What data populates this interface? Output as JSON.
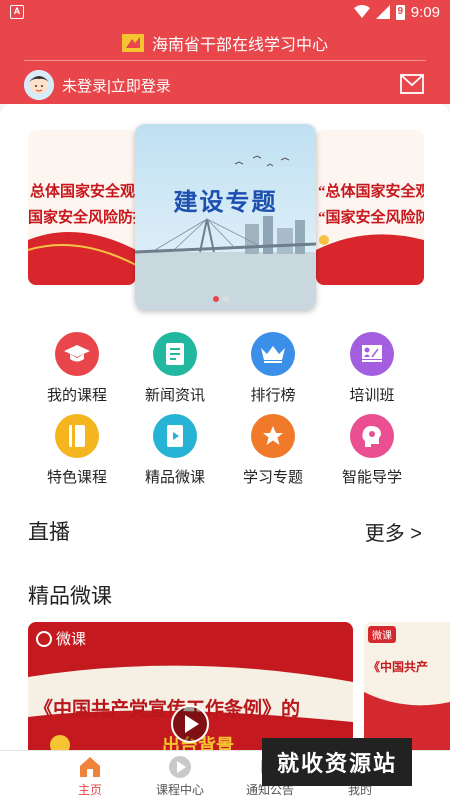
{
  "statusbar": {
    "left_glyph": "A",
    "time": "9:09",
    "battery": "9"
  },
  "header": {
    "title": "海南省干部在线学习中心",
    "login_text": "未登录|立即登录"
  },
  "carousel": {
    "center_caption": "建设专题",
    "left_lines": [
      "总体国家安全观",
      "国家安全风险防控"
    ],
    "right_lines": [
      "“总体国家安全观",
      "“国家安全风险防"
    ],
    "active_index": 0,
    "slide_count": 2
  },
  "grid": {
    "items": [
      {
        "label": "我的课程",
        "icon": "graduation-cap-icon",
        "color": "#e8464a"
      },
      {
        "label": "新闻资讯",
        "icon": "document-icon",
        "color": "#22b8a0"
      },
      {
        "label": "排行榜",
        "icon": "crown-icon",
        "color": "#3b8fe8"
      },
      {
        "label": "培训班",
        "icon": "chalkboard-icon",
        "color": "#a45ee0"
      },
      {
        "label": "特色课程",
        "icon": "book-icon",
        "color": "#f5b51e"
      },
      {
        "label": "精品微课",
        "icon": "play-tablet-icon",
        "color": "#27b3d6"
      },
      {
        "label": "学习专题",
        "icon": "star-icon",
        "color": "#f07a2a"
      },
      {
        "label": "智能导学",
        "icon": "head-brain-icon",
        "color": "#ea4f92"
      }
    ]
  },
  "sections": {
    "live_title": "直播",
    "more_label": "更多 >",
    "micro_title": "精品微课"
  },
  "courses": {
    "main_badge": "微课",
    "main_title_line1": "《中国共产党宣传工作条例》的",
    "main_title_line2": "出台背景",
    "side_badge": "微课",
    "side_title": "《中国共产"
  },
  "bottomnav": {
    "items": [
      {
        "label": "主页",
        "active": true
      },
      {
        "label": "课程中心",
        "active": false
      },
      {
        "label": "通知公告",
        "active": false
      },
      {
        "label": "我的",
        "active": false
      }
    ]
  },
  "watermark": "就收资源站",
  "colors": {
    "brand_red": "#e8464a"
  }
}
